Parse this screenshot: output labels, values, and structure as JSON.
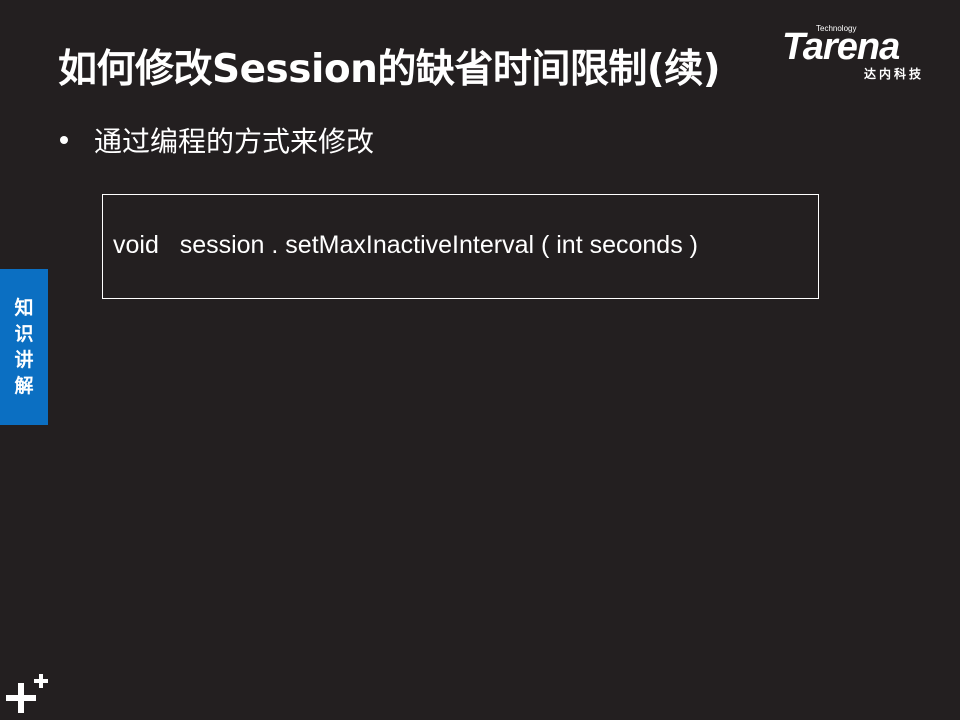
{
  "header": {
    "title": "如何修改Session的缺省时间限制(续)"
  },
  "logo": {
    "tagline": "Technology",
    "wordmark": "Tarena",
    "chinese_name": "达内科技"
  },
  "content": {
    "bullet": "通过编程的方式来修改",
    "code": "void   session . setMaxInactiveInterval ( int seconds )"
  },
  "side_tab": {
    "label": "知识讲解"
  },
  "icons": {
    "corner": "plus-icon"
  },
  "colors": {
    "background": "#231f20",
    "accent": "#0b6fc2",
    "text": "#ffffff"
  }
}
